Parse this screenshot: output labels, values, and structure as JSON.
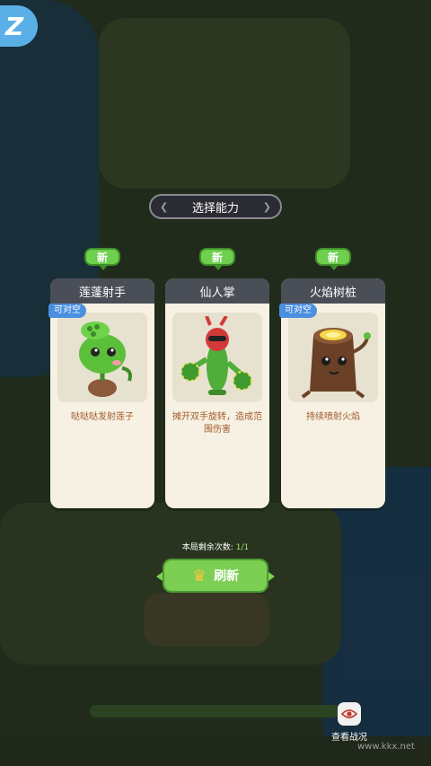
{
  "title": "选择能力",
  "cards": [
    {
      "name": "莲蓬射手",
      "new_badge": "新",
      "tag": "可对空",
      "desc": "哒哒哒发射莲子",
      "icon": "lotus-shooter-icon"
    },
    {
      "name": "仙人掌",
      "new_badge": "新",
      "tag": "",
      "desc": "摊开双手旋转，造成范围伤害",
      "icon": "cactus-icon"
    },
    {
      "name": "火焰树桩",
      "new_badge": "新",
      "tag": "可对空",
      "desc": "持续喷射火焰",
      "icon": "fire-stump-icon"
    }
  ],
  "refresh": {
    "remaining_label": "本局剩余次数:",
    "remaining_count": "1/1",
    "button_label": "刷新",
    "icon": "crown-icon"
  },
  "view_battle": {
    "label": "查看战况",
    "icon": "eye-icon"
  },
  "watermark": "www.kkx.net",
  "colors": {
    "accent_green": "#7ccf52",
    "card_bg": "#f6f1e2",
    "tag_blue": "#4a8fe0",
    "desc_orange": "#a35a2b"
  }
}
